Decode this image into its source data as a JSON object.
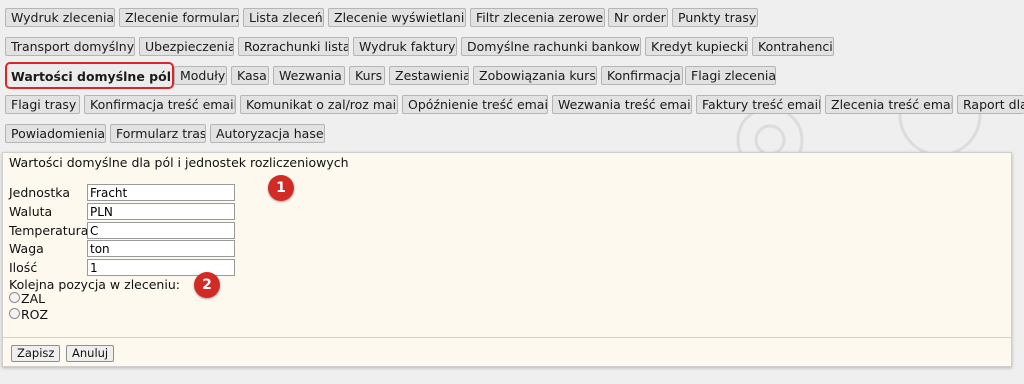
{
  "tabs": {
    "row1": [
      "Wydruk zlecenia",
      "Zlecenie formularz",
      "Lista zleceń",
      "Zlecenie wyświetlanie",
      "Filtr zlecenia zerowe",
      "Nr order",
      "Punkty trasy"
    ],
    "row2": [
      "Transport domyślny",
      "Ubezpieczenia",
      "Rozrachunki lista",
      "Wydruk faktury",
      "Domyślne rachunki bankowe",
      "Kredyt kupiecki",
      "Kontrahenci"
    ],
    "row3": [
      "Wartości domyślne pól",
      "Moduły",
      "Kasa",
      "Wezwania",
      "Kurs",
      "Zestawienia",
      "Zobowiązania kurs",
      "Konfirmacja",
      "Flagi zlecenia"
    ],
    "row4": [
      "Flagi trasy",
      "Konfirmacja treść email",
      "Komunikat o zal/roz mail",
      "Opóźnienie treść email",
      "Wezwania treść email",
      "Faktury treść email",
      "Zlecenia treść email",
      "Raport dla"
    ],
    "row5": [
      "Powiadomienia",
      "Formularz tras",
      "Autoryzacja haseł"
    ]
  },
  "panel": {
    "title": "Wartości domyślne dla pól i jednostek rozliczeniowych",
    "fields": [
      {
        "label": "Jednostka",
        "value": "Fracht"
      },
      {
        "label": "Waluta",
        "value": "PLN"
      },
      {
        "label": "Temperatura",
        "value": "C"
      },
      {
        "label": "Waga",
        "value": "ton"
      },
      {
        "label": "Ilość",
        "value": "1"
      }
    ],
    "position_label": "Kolejna pozycja w zleceniu:",
    "radio_options": [
      "ZAL",
      "ROZ"
    ],
    "save_label": "Zapisz",
    "cancel_label": "Anuluj"
  },
  "annotations": {
    "badge1": "1",
    "badge2": "2"
  },
  "colors": {
    "accent": "#d9262b",
    "panel_bg": "#fdf9ef",
    "page_bg": "#efefef"
  }
}
